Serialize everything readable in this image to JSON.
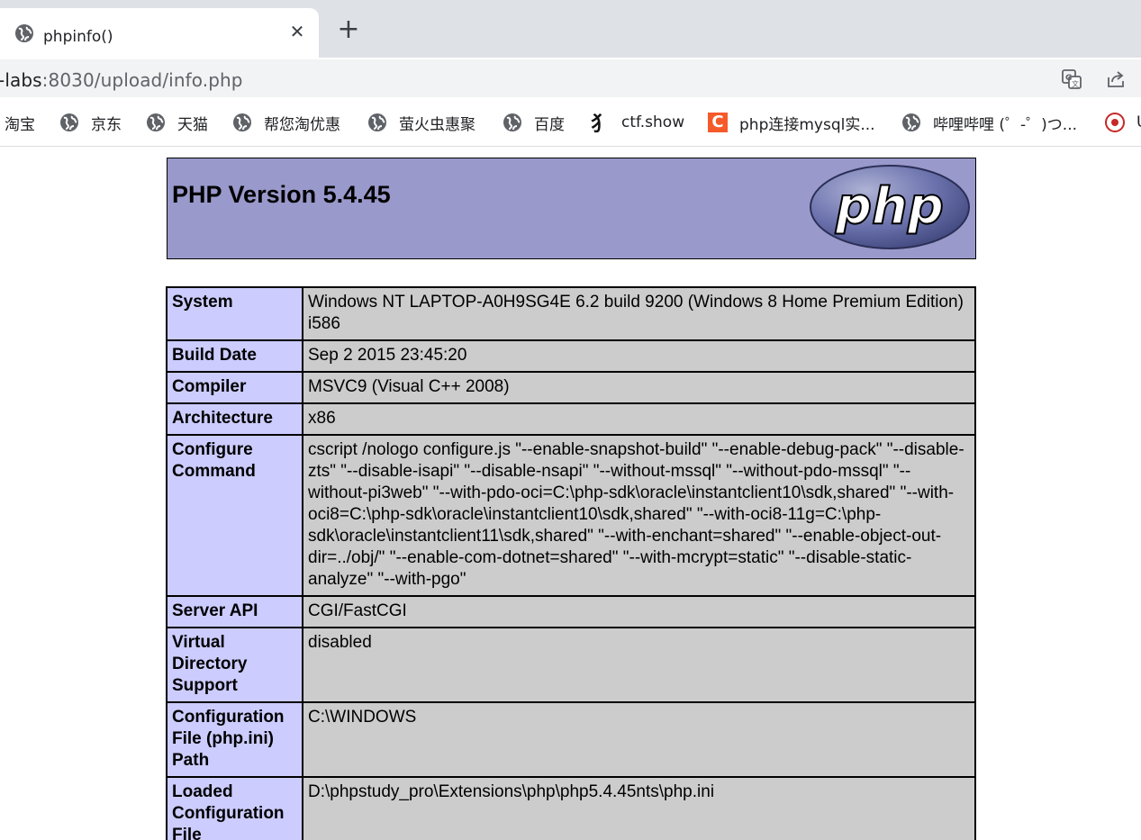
{
  "browser": {
    "tab": {
      "title": "phpinfo()",
      "close_glyph": "✕",
      "new_tab_glyph": "+"
    },
    "address": {
      "host_part": "-labs",
      "rest": ":8030/upload/info.php"
    },
    "icons": {
      "translate": "translate-icon",
      "share": "share-icon"
    },
    "bookmarks": [
      {
        "label": "淘宝",
        "icon": "none"
      },
      {
        "label": "京东",
        "icon": "globe-icon"
      },
      {
        "label": "天猫",
        "icon": "globe-icon"
      },
      {
        "label": "帮您淘优惠",
        "icon": "globe-icon"
      },
      {
        "label": "萤火虫惠聚",
        "icon": "globe-icon"
      },
      {
        "label": "百度",
        "icon": "globe-icon"
      },
      {
        "label": "ctf.show",
        "icon": "ctfshow-icon"
      },
      {
        "label": "php连接mysql实...",
        "icon": "csdn-c-icon"
      },
      {
        "label": "哔哩哔哩 (゜-゜)つ...",
        "icon": "globe-icon"
      },
      {
        "label": "U",
        "icon": "red-seal-icon"
      }
    ],
    "csdn_letter": "C",
    "ctf_glyph": "犭"
  },
  "page": {
    "version_title": "PHP Version 5.4.45",
    "logo_text": "php",
    "rows": [
      {
        "key": "System",
        "value": "Windows NT LAPTOP-A0H9SG4E 6.2 build 9200 (Windows 8 Home Premium Edition) i586"
      },
      {
        "key": "Build Date",
        "value": "Sep 2 2015 23:45:20"
      },
      {
        "key": "Compiler",
        "value": "MSVC9 (Visual C++ 2008)"
      },
      {
        "key": "Architecture",
        "value": "x86"
      },
      {
        "key": "Configure Command",
        "value": "cscript /nologo configure.js \"--enable-snapshot-build\" \"--enable-debug-pack\" \"--disable-zts\" \"--disable-isapi\" \"--disable-nsapi\" \"--without-mssql\" \"--without-pdo-mssql\" \"--without-pi3web\" \"--with-pdo-oci=C:\\php-sdk\\oracle\\instantclient10\\sdk,shared\" \"--with-oci8=C:\\php-sdk\\oracle\\instantclient10\\sdk,shared\" \"--with-oci8-11g=C:\\php-sdk\\oracle\\instantclient11\\sdk,shared\" \"--with-enchant=shared\" \"--enable-object-out-dir=../obj/\" \"--enable-com-dotnet=shared\" \"--with-mcrypt=static\" \"--disable-static-analyze\" \"--with-pgo\""
      },
      {
        "key": "Server API",
        "value": "CGI/FastCGI"
      },
      {
        "key": "Virtual Directory Support",
        "value": "disabled"
      },
      {
        "key": "Configuration File (php.ini) Path",
        "value": "C:\\WINDOWS"
      },
      {
        "key": "Loaded Configuration File",
        "value": "D:\\phpstudy_pro\\Extensions\\php\\php5.4.45nts\\php.ini"
      }
    ]
  }
}
